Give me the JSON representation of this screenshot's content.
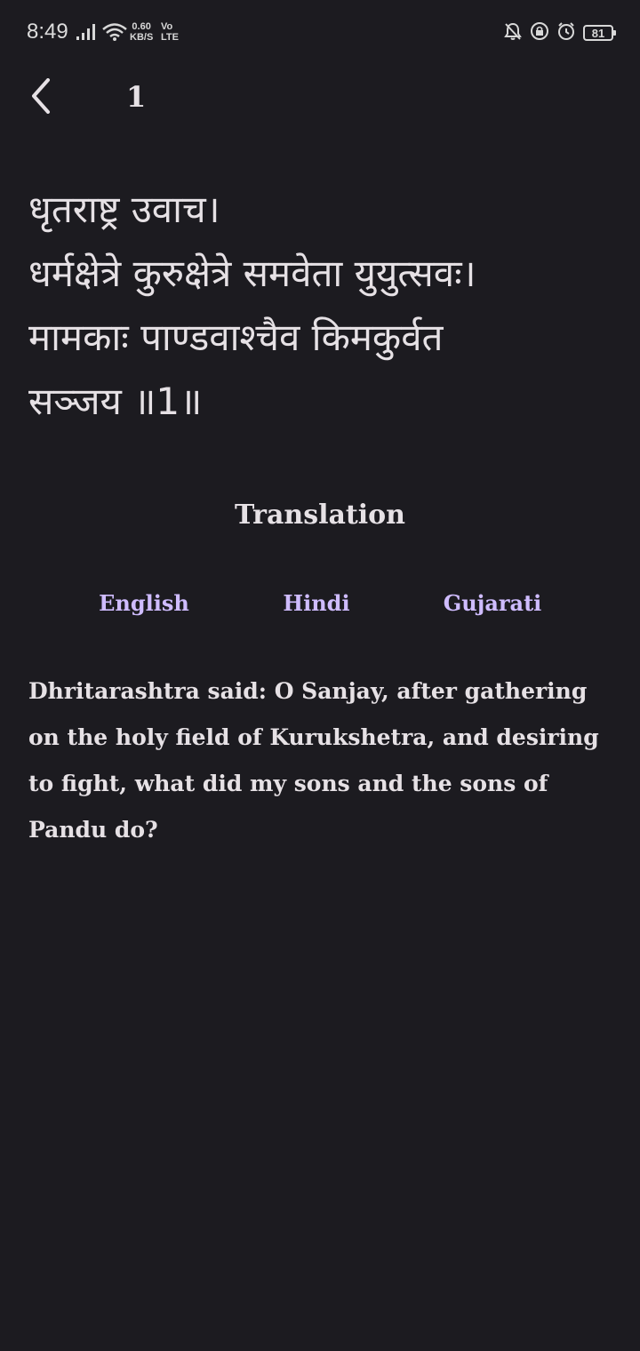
{
  "status_bar": {
    "time": "8:49",
    "net_speed_value": "0.60",
    "net_speed_unit": "KB/S",
    "volte_top": "Vo",
    "volte_bottom": "LTE",
    "battery": "81",
    "icons": [
      "signal-icon",
      "wifi-icon",
      "bell-off-icon",
      "lock-icon",
      "alarm-icon",
      "battery-icon"
    ]
  },
  "header": {
    "title": "1",
    "back_icon": "back-arrow-icon"
  },
  "verse": {
    "text": "धृतराष्ट्र उवाच।\nधर्मक्षेत्रे कुरुक्षेत्रे समवेता युयुत्सवः।\nमामकाः पाण्डवाश्चैव किमकुर्वत\nसञ्जय ॥1॥"
  },
  "translation": {
    "heading": "Translation",
    "tabs": [
      {
        "label": "English"
      },
      {
        "label": "Hindi"
      },
      {
        "label": "Gujarati"
      }
    ],
    "text": "Dhritarashtra said: O Sanjay, after gathering on the holy field of Kurukshetra, and desiring to fight, what did my sons and the sons of Pandu do?"
  },
  "colors": {
    "background": "#1c1b20",
    "text": "#e6e1e5",
    "accent": "#cfbcff"
  }
}
